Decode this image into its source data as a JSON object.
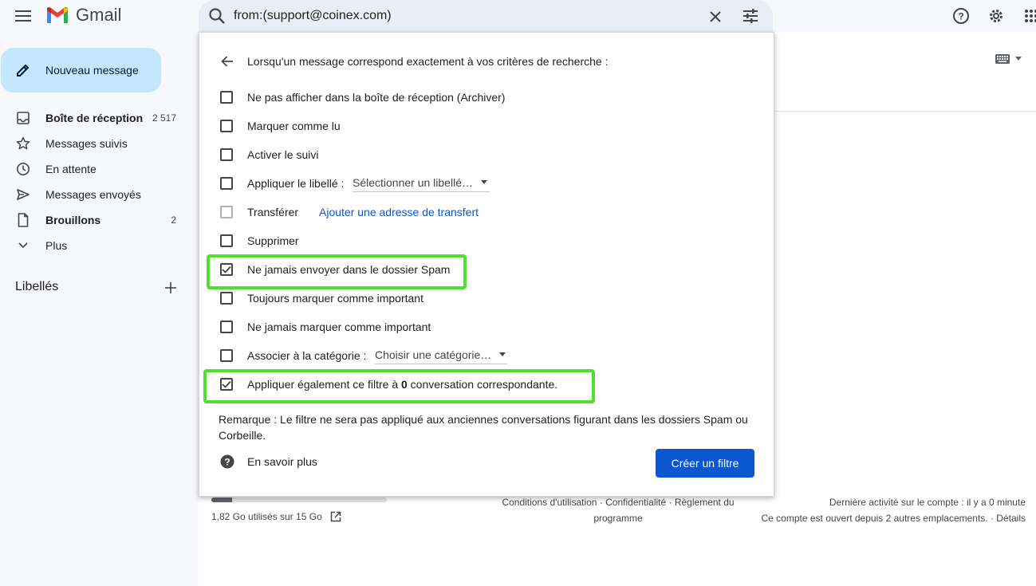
{
  "header": {
    "app_name": "Gmail",
    "search_value": "from:(support@coinex.com)"
  },
  "sidebar": {
    "compose_label": "Nouveau message",
    "items": [
      {
        "label": "Boîte de réception",
        "count": "2 517",
        "icon": "inbox-icon",
        "bold": true
      },
      {
        "label": "Messages suivis",
        "count": "",
        "icon": "star-icon",
        "bold": false
      },
      {
        "label": "En attente",
        "count": "",
        "icon": "clock-icon",
        "bold": false
      },
      {
        "label": "Messages envoyés",
        "count": "",
        "icon": "send-icon",
        "bold": false
      },
      {
        "label": "Brouillons",
        "count": "2",
        "icon": "draft-icon",
        "bold": true
      },
      {
        "label": "Plus",
        "count": "",
        "icon": "chevron-down-icon",
        "bold": false
      }
    ],
    "labels_header": "Libellés"
  },
  "filter_panel": {
    "title": "Lorsqu'un message correspond exactement à vos critères de recherche :",
    "options": [
      {
        "label": "Ne pas afficher dans la boîte de réception (Archiver)",
        "checked": false
      },
      {
        "label": "Marquer comme lu",
        "checked": false
      },
      {
        "label": "Activer le suivi",
        "checked": false
      },
      {
        "label": "Appliquer le libellé :",
        "checked": false
      },
      {
        "label": "Transférer",
        "checked": false
      },
      {
        "label": "Supprimer",
        "checked": false
      },
      {
        "label": "Ne jamais envoyer dans le dossier Spam",
        "checked": true
      },
      {
        "label": "Toujours marquer comme important",
        "checked": false
      },
      {
        "label": "Ne jamais marquer comme important",
        "checked": false
      },
      {
        "label": "Associer à la catégorie :",
        "checked": false
      },
      {
        "label_prefix": "Appliquer également ce filtre à ",
        "label_count": "0",
        "label_suffix": " conversation correspondante.",
        "checked": true
      }
    ],
    "label_dropdown": "Sélectionner un libellé…",
    "forward_link": "Ajouter une adresse de transfert",
    "category_dropdown": "Choisir une catégorie…",
    "note": "Remarque : Le filtre ne sera pas appliqué aux anciennes conversations figurant dans les dossiers Spam ou Corbeille.",
    "learn_more": "En savoir plus",
    "create_button": "Créer un filtre"
  },
  "footer": {
    "storage_text": "1,82 Go utilisés sur 15 Go",
    "storage_fraction": 0.12,
    "links_line1": "Conditions d'utilisation · Confidentialité · Règlement du",
    "links_line2": "programme",
    "activity_line1": "Dernière activité sur le compte : il y a 0 minute",
    "activity_line2": "Ce compte est ouvert depuis 2 autres emplacements. · Détails"
  },
  "colors": {
    "highlight": "#4ee22c",
    "primary_button": "#0b57d0",
    "compose_bg": "#c2e7ff"
  }
}
